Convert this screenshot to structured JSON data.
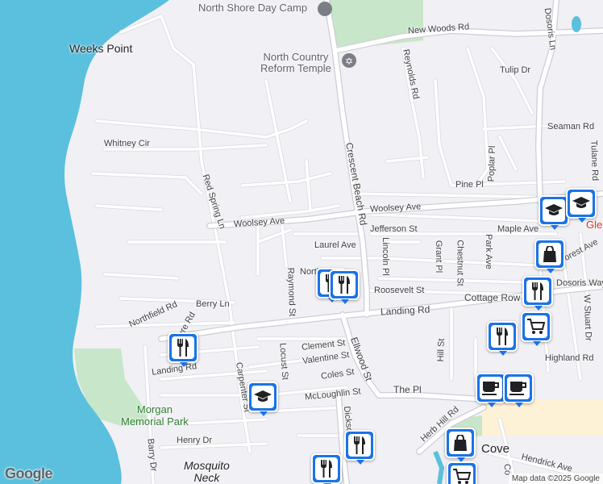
{
  "map": {
    "places": {
      "weeks_point": "Weeks Point",
      "mosquito_neck": "Mosquito\nNeck",
      "cove": "Cove",
      "glen": "Gle"
    },
    "pois": {
      "north_shore_day_camp": "North Shore Day Camp",
      "north_country_reform_temple": "North Country\nReform Temple",
      "morgan_memorial_park": "Morgan\nMemorial Park"
    },
    "streets": {
      "new_woods_rd": "New Woods Rd",
      "dosoris_ln": "Dosoris Ln",
      "reynolds_rd": "Reynolds Rd",
      "tulip_dr": "Tulip Dr",
      "seaman_rd": "Seaman Rd",
      "tulane_rd": "Tulane Rd",
      "whitney_cir": "Whitney Cir",
      "poplar_pl": "Poplar Pl",
      "pine_pl": "Pine Pl",
      "crescent_beach_rd": "Crescent Beach Rd",
      "red_spring_ln": "Red Spring Ln",
      "woolsey_ave_w": "Woolsey Ave",
      "woolsey_ave_e": "Woolsey Ave",
      "jefferson_st": "Jefferson St",
      "maple_ave": "Maple Ave",
      "forest_ave": "orest Ave",
      "laurel_ave": "Laurel Ave",
      "lincoln_pl": "Lincoln Pl",
      "grant_pl": "Grant Pl",
      "chestnut_st": "Chestnut St",
      "park_ave": "Park Ave",
      "north_st": "North St",
      "raymond_st": "Raymond St",
      "roosevelt_st": "Roosevelt St",
      "cottage_row": "Cottage Row",
      "dosoris_way": "Dosoris Way",
      "w_stuart_dr": "W Stuart Dr",
      "berry_ln": "Berry Ln",
      "northfield_rd": "Northfield Rd",
      "landing_rd": "Landing Rd",
      "spring_shore_rd": "Shore Rd",
      "highland_rd": "Highland Rd",
      "ellwood_st": "Ellwood St",
      "clement_st": "Clement St",
      "locust_st": "Locust St",
      "valentine_st": "Valentine St",
      "hill_st": "Hill St",
      "landing_rd_w": "Landing Rd",
      "coles_st": "Coles St",
      "carpenter_st": "Carpenter St",
      "the_pl": "The Pl",
      "mcloughlin_st": "McLoughlin St",
      "dickson_st": "Dickso",
      "herb_hill_rd": "Herb Hill Rd",
      "henry_dr": "Henry Dr",
      "barry_dr": "Barry Dr",
      "hendrick_ave": "Hendrick Ave",
      "co_st": "Co"
    },
    "markers": [
      {
        "icon": "school-icon",
        "label": "school"
      },
      {
        "icon": "school-icon",
        "label": "school"
      },
      {
        "icon": "shopping-bag-icon",
        "label": "store"
      },
      {
        "icon": "restaurant-icon",
        "label": "restaurant"
      },
      {
        "icon": "restaurant-icon",
        "label": "restaurant"
      },
      {
        "icon": "restaurant-icon",
        "label": "restaurant"
      },
      {
        "icon": "restaurant-icon",
        "label": "restaurant"
      },
      {
        "icon": "restaurant-icon",
        "label": "restaurant"
      },
      {
        "icon": "shopping-cart-icon",
        "label": "grocery"
      },
      {
        "icon": "cafe-icon",
        "label": "cafe"
      },
      {
        "icon": "cafe-icon",
        "label": "cafe"
      },
      {
        "icon": "school-icon",
        "label": "school"
      },
      {
        "icon": "restaurant-icon",
        "label": "restaurant"
      },
      {
        "icon": "restaurant-icon",
        "label": "restaurant"
      },
      {
        "icon": "shopping-bag-icon",
        "label": "store"
      },
      {
        "icon": "shopping-cart-icon",
        "label": "grocery"
      }
    ],
    "brand": "Google",
    "attribution": "Map data ©2025 Google",
    "colors": {
      "water": "#5bc0de",
      "land": "#f1f0f4",
      "park": "#c8e6c9",
      "road": "#ffffff",
      "road_edge": "#d6d5db",
      "marker": "#1a73e8",
      "commercial": "#fdf1d6"
    }
  }
}
